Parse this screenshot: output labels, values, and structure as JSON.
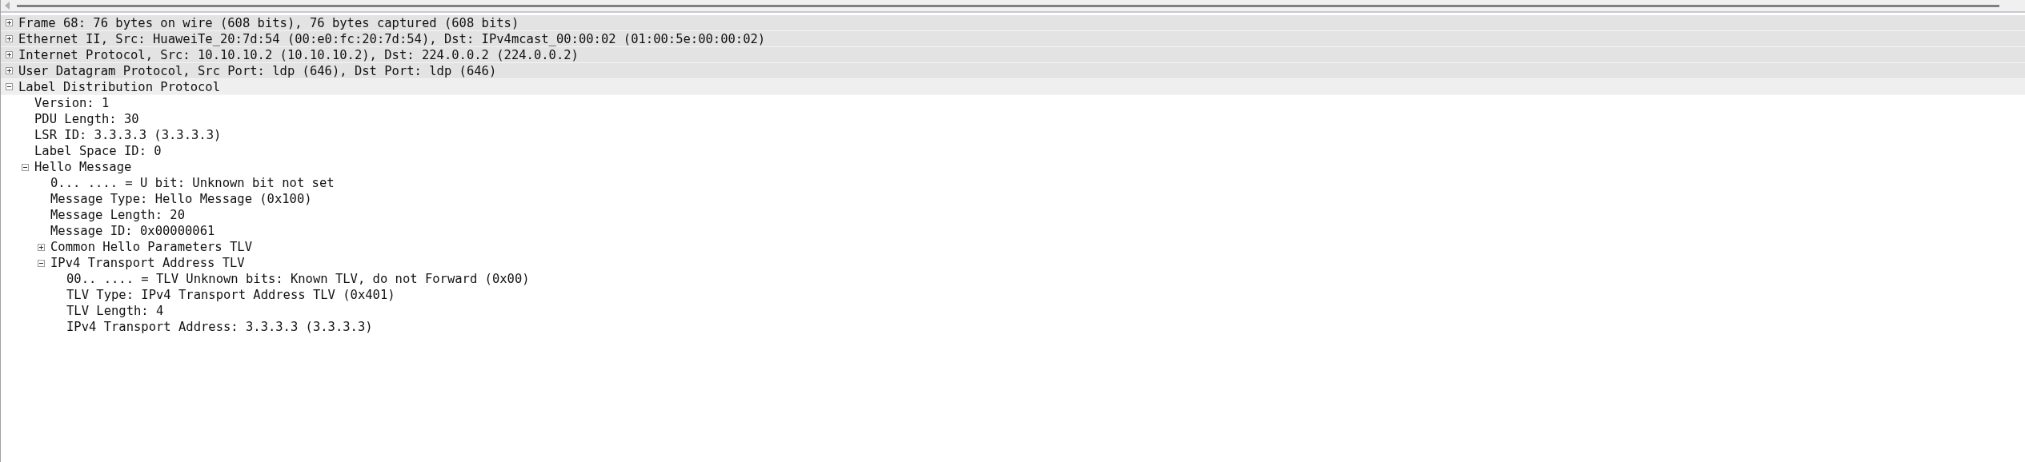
{
  "tree": [
    {
      "label": "Frame 68: 76 bytes on wire (608 bits), 76 bytes captured (608 bits)",
      "expanded": false
    },
    {
      "label": "Ethernet II, Src: HuaweiTe_20:7d:54 (00:e0:fc:20:7d:54), Dst: IPv4mcast_00:00:02 (01:00:5e:00:00:02)",
      "expanded": false
    },
    {
      "label": "Internet Protocol, Src: 10.10.10.2 (10.10.10.2), Dst: 224.0.0.2 (224.0.0.2)",
      "expanded": false
    },
    {
      "label": "User Datagram Protocol, Src Port: ldp (646), Dst Port: ldp (646)",
      "expanded": false
    },
    {
      "label": "Label Distribution Protocol",
      "expanded": true,
      "children": [
        {
          "label": "Version: 1"
        },
        {
          "label": "PDU Length: 30"
        },
        {
          "label": "LSR ID: 3.3.3.3 (3.3.3.3)"
        },
        {
          "label": "Label Space ID: 0"
        },
        {
          "label": "Hello Message",
          "expanded": true,
          "children": [
            {
              "label": "0... .... = U bit: Unknown bit not set"
            },
            {
              "label": "Message Type: Hello Message (0x100)"
            },
            {
              "label": "Message Length: 20"
            },
            {
              "label": "Message ID: 0x00000061"
            },
            {
              "label": "Common Hello Parameters TLV",
              "expanded": false
            },
            {
              "label": "IPv4 Transport Address TLV",
              "expanded": true,
              "children": [
                {
                  "label": "00.. .... = TLV Unknown bits: Known TLV, do not Forward (0x00)"
                },
                {
                  "label": "TLV Type: IPv4 Transport Address TLV (0x401)"
                },
                {
                  "label": "TLV Length: 4"
                },
                {
                  "label": "IPv4 Transport Address: 3.3.3.3 (3.3.3.3)"
                }
              ]
            }
          ]
        }
      ]
    }
  ]
}
